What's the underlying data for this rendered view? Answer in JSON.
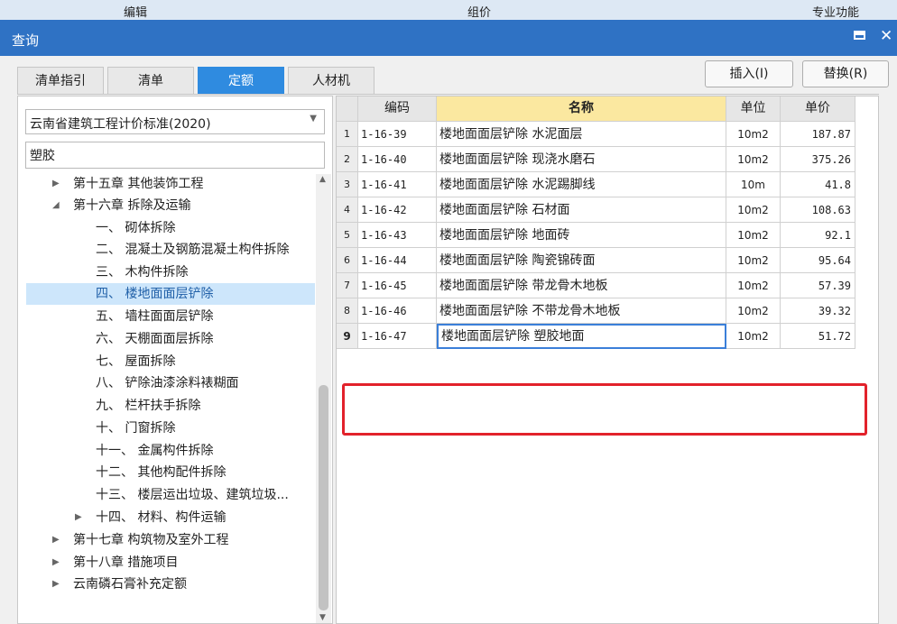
{
  "top_menu": {
    "edit": "编辑",
    "group_price": "组价",
    "special": "专业功能"
  },
  "window": {
    "title": "查询"
  },
  "tabs": [
    {
      "label": "清单指引"
    },
    {
      "label": "清单"
    },
    {
      "label": "定额"
    },
    {
      "label": "人材机"
    }
  ],
  "buttons": {
    "insert": "插入(I)",
    "replace": "替换(R)"
  },
  "left": {
    "standard": "云南省建筑工程计价标准(2020)",
    "search_value": "塑胶",
    "tree": [
      {
        "label": "第十五章 其他装饰工程",
        "toggle": "▶"
      },
      {
        "label": "第十六章 拆除及运输",
        "toggle": "◢"
      },
      {
        "label": "一、 砌体拆除"
      },
      {
        "label": "二、 混凝土及钢筋混凝土构件拆除"
      },
      {
        "label": "三、 木构件拆除"
      },
      {
        "label": "四、 楼地面面层铲除"
      },
      {
        "label": "五、 墙柱面面层铲除"
      },
      {
        "label": "六、 天棚面面层拆除"
      },
      {
        "label": "七、 屋面拆除"
      },
      {
        "label": "八、 铲除油漆涂料裱糊面"
      },
      {
        "label": "九、 栏杆扶手拆除"
      },
      {
        "label": "十、 门窗拆除"
      },
      {
        "label": "十一、 金属构件拆除"
      },
      {
        "label": "十二、 其他构配件拆除"
      },
      {
        "label": "十三、 楼层运出垃圾、建筑垃圾..."
      },
      {
        "label": "十四、 材料、构件运输",
        "toggle": "▶"
      },
      {
        "label": "第十七章 构筑物及室外工程",
        "toggle": "▶"
      },
      {
        "label": "第十八章 措施项目",
        "toggle": "▶"
      },
      {
        "label": "云南磷石膏补充定额",
        "toggle": "▶"
      }
    ]
  },
  "table": {
    "headers": {
      "code": "编码",
      "name": "名称",
      "unit": "单位",
      "price": "单价"
    },
    "rows": [
      {
        "idx": "1",
        "code": "1-16-39",
        "name": "楼地面面层铲除 水泥面层",
        "unit": "10m2",
        "price": "187.87"
      },
      {
        "idx": "2",
        "code": "1-16-40",
        "name": "楼地面面层铲除 现浇水磨石",
        "unit": "10m2",
        "price": "375.26"
      },
      {
        "idx": "3",
        "code": "1-16-41",
        "name": "楼地面面层铲除 水泥踢脚线",
        "unit": "10m",
        "price": "41.8"
      },
      {
        "idx": "4",
        "code": "1-16-42",
        "name": "楼地面面层铲除 石材面",
        "unit": "10m2",
        "price": "108.63"
      },
      {
        "idx": "5",
        "code": "1-16-43",
        "name": "楼地面面层铲除 地面砖",
        "unit": "10m2",
        "price": "92.1"
      },
      {
        "idx": "6",
        "code": "1-16-44",
        "name": "楼地面面层铲除 陶瓷锦砖面",
        "unit": "10m2",
        "price": "95.64"
      },
      {
        "idx": "7",
        "code": "1-16-45",
        "name": "楼地面面层铲除 带龙骨木地板",
        "unit": "10m2",
        "price": "57.39"
      },
      {
        "idx": "8",
        "code": "1-16-46",
        "name": "楼地面面层铲除 不带龙骨木地板",
        "unit": "10m2",
        "price": "39.32"
      },
      {
        "idx": "9",
        "code": "1-16-47",
        "name": "楼地面面层铲除 塑胶地面",
        "unit": "10m2",
        "price": "51.72"
      }
    ]
  },
  "colors": {
    "title_bar": "#2f72c4",
    "active_tab": "#2f8be0",
    "highlight_box": "#e2222b",
    "selected_node": "#cde6fb"
  }
}
